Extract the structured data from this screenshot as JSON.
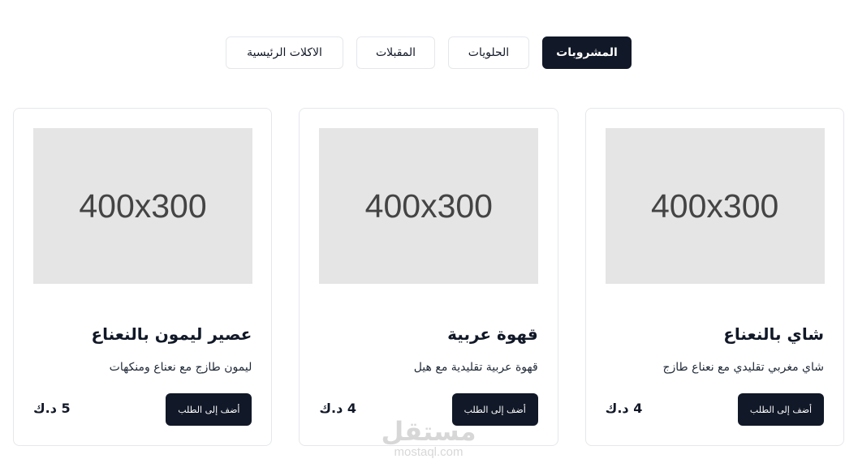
{
  "tabs": [
    {
      "label": "المشروبات",
      "active": true
    },
    {
      "label": "الحلويات",
      "active": false
    },
    {
      "label": "المقبلات",
      "active": false
    },
    {
      "label": "الاكلات الرئيسية",
      "active": false
    }
  ],
  "cards": [
    {
      "image_text": "400x300",
      "title": "شاي بالنعناع",
      "description": "شاي مغربي تقليدي مع نعناع طازج",
      "price": "4 د.ك",
      "button_label": "أضف إلى الطلب"
    },
    {
      "image_text": "400x300",
      "title": "قهوة عربية",
      "description": "قهوة عربية تقليدية مع هيل",
      "price": "4 د.ك",
      "button_label": "أضف إلى الطلب"
    },
    {
      "image_text": "400x300",
      "title": "عصير ليمون بالنعناع",
      "description": "ليمون طازج مع نعناع ومنكهات",
      "price": "5 د.ك",
      "button_label": "أضف إلى الطلب"
    }
  ],
  "watermark": {
    "logo_text": "مستقل",
    "url": "mostaql.com"
  },
  "colors": {
    "primary": "#111827",
    "border": "#e5e7eb",
    "placeholder": "#e5e5e5"
  }
}
